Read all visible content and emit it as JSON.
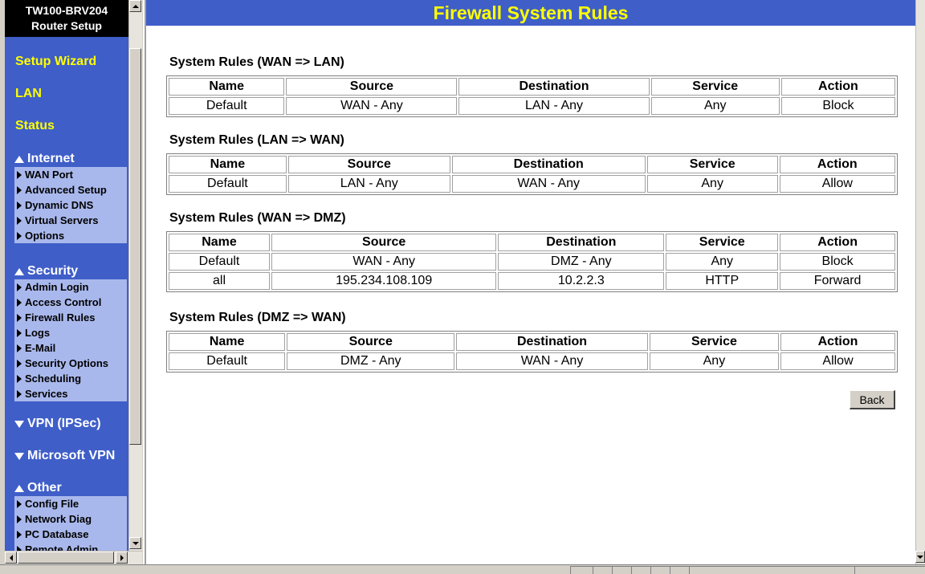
{
  "nav": {
    "header_line1": "TW100-BRV204",
    "header_line2": "Router Setup",
    "links": [
      "Setup Wizard",
      "LAN",
      "Status"
    ],
    "internet": {
      "label": "Internet",
      "items": [
        "WAN Port",
        "Advanced Setup",
        "Dynamic DNS",
        "Virtual Servers",
        "Options"
      ]
    },
    "security": {
      "label": "Security",
      "items": [
        "Admin Login",
        "Access Control",
        "Firewall Rules",
        "Logs",
        "E-Mail",
        "Security Options",
        "Scheduling",
        "Services"
      ]
    },
    "vpn_ipsec": "VPN (IPSec)",
    "microsoft_vpn": "Microsoft VPN",
    "other": {
      "label": "Other",
      "items": [
        "Config File",
        "Network Diag",
        "PC Database",
        "Remote Admin"
      ]
    }
  },
  "page": {
    "title": "Firewall System Rules",
    "columns": [
      "Name",
      "Source",
      "Destination",
      "Service",
      "Action"
    ],
    "sections": [
      {
        "title": "System Rules (WAN => LAN)",
        "rows": [
          [
            "Default",
            "WAN - Any",
            "LAN - Any",
            "Any",
            "Block"
          ]
        ]
      },
      {
        "title": "System Rules (LAN => WAN)",
        "rows": [
          [
            "Default",
            "LAN - Any",
            "WAN - Any",
            "Any",
            "Allow"
          ]
        ]
      },
      {
        "title": "System Rules (WAN => DMZ)",
        "rows": [
          [
            "Default",
            "WAN - Any",
            "DMZ - Any",
            "Any",
            "Block"
          ],
          [
            "all",
            "195.234.108.109",
            "10.2.2.3",
            "HTTP",
            "Forward"
          ]
        ]
      },
      {
        "title": "System Rules (DMZ => WAN)",
        "rows": [
          [
            "Default",
            "DMZ - Any",
            "WAN - Any",
            "Any",
            "Allow"
          ]
        ]
      }
    ],
    "back_label": "Back"
  },
  "colors": {
    "nav_bg": "#3f5ec8",
    "link_yellow": "#ffff00",
    "subnav_bg": "#a9b8ec",
    "title_bg": "#3f5ec8"
  }
}
